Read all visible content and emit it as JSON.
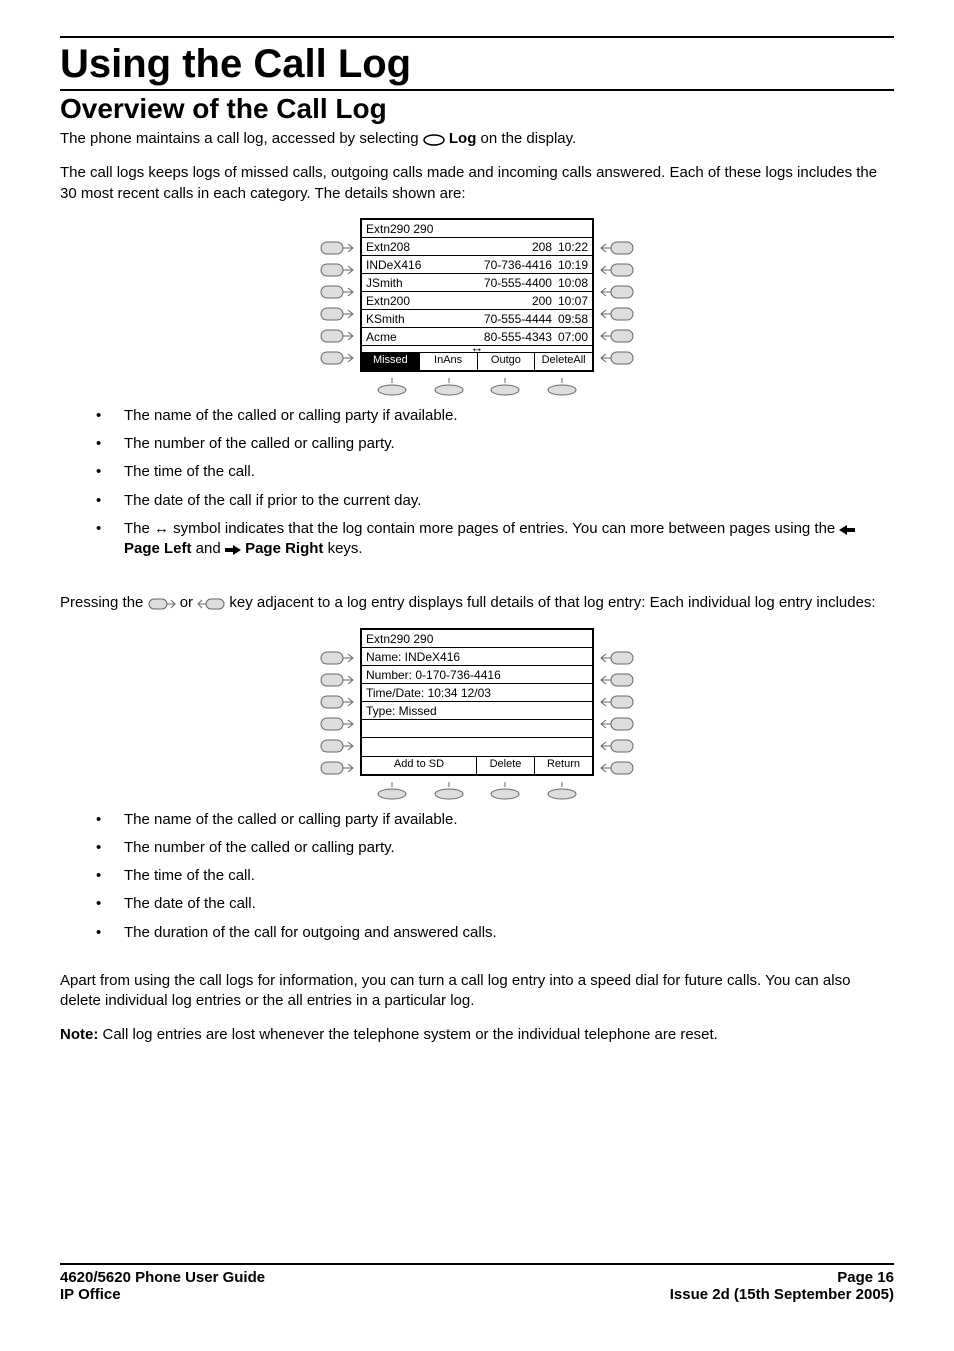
{
  "headings": {
    "h1": "Using the Call Log",
    "h2": "Overview of the Call Log"
  },
  "intro": {
    "p1_a": "The phone maintains a call log, accessed by selecting ",
    "p1_log": "Log",
    "p1_b": " on the display.",
    "p2": "The call logs keeps logs of missed calls, outgoing calls made and incoming calls answered. Each of these logs includes the 30 most recent calls in each category. The details shown are:"
  },
  "lcd1": {
    "title": "Extn290 290",
    "rows": [
      {
        "name": "Extn208",
        "num": "208",
        "time": "10:22"
      },
      {
        "name": "INDeX416",
        "num": "70-736-4416",
        "time": "10:19"
      },
      {
        "name": "JSmith",
        "num": "70-555-4400",
        "time": "10:08"
      },
      {
        "name": "Extn200",
        "num": "200",
        "time": "10:07"
      },
      {
        "name": "KSmith",
        "num": "70-555-4444",
        "time": "09:58"
      },
      {
        "name": "Acme",
        "num": "80-555-4343",
        "time": "07:00"
      }
    ],
    "tabs": [
      "Missed",
      "InAns",
      "Outgo",
      "DeleteAll"
    ]
  },
  "bullets1": {
    "b1": "The name of the called or calling party if available.",
    "b2": "The number of the called or calling party.",
    "b3": "The time of the call.",
    "b4": "The date of the call if prior to the current day.",
    "b5_a": "The ",
    "b5_sym": "↔",
    "b5_b": " symbol indicates that the log contain more pages of entries. You can more between pages using the ",
    "b5_pl": "Page Left",
    "b5_and": " and ",
    "b5_pr": "Page Right",
    "b5_end": " keys."
  },
  "mid": {
    "p_a": "Pressing the ",
    "p_b": " or ",
    "p_c": " key adjacent to a log entry displays full details of that log entry: Each individual log entry includes:"
  },
  "lcd2": {
    "title": "Extn290 290",
    "rows": [
      "Name: INDeX416",
      "Number: 0-170-736-4416",
      "Time/Date: 10:34  12/03",
      "Type: Missed"
    ],
    "tabs": [
      "Add to SD",
      "Delete",
      "Return"
    ]
  },
  "bullets2": {
    "b1": "The name of the called or calling party if available.",
    "b2": "The number of the called or calling party.",
    "b3": "The time of the call.",
    "b4": "The date of the call.",
    "b5": "The duration of the call for outgoing and answered calls."
  },
  "tail": {
    "p1": "Apart from using the call logs for information, you can turn a call log entry into a speed dial for future calls. You can also delete individual log entries or the all entries in a particular log.",
    "note_label": "Note:",
    "note_body": " Call log entries are lost whenever the telephone system or the individual telephone are reset."
  },
  "footer": {
    "left1": "4620/5620 Phone User Guide",
    "right1": "Page 16",
    "left2": "IP Office",
    "right2": "Issue 2d (15th September 2005)"
  }
}
